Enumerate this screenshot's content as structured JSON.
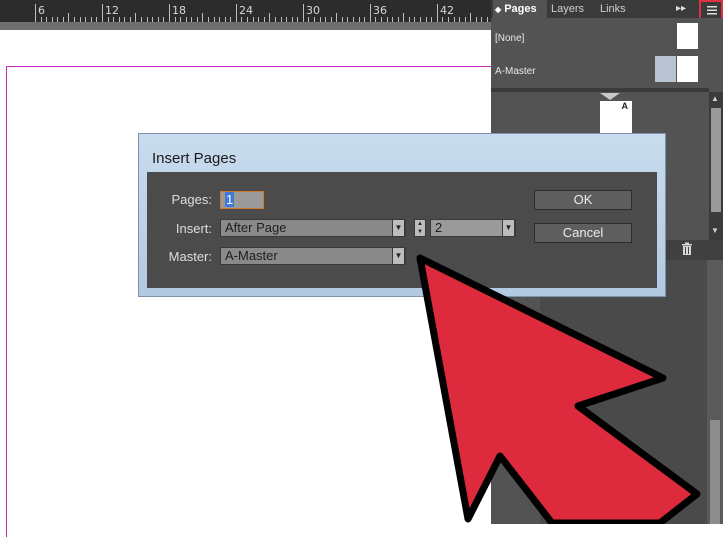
{
  "ruler": {
    "labels": [
      "6",
      "12",
      "18",
      "24",
      "30",
      "36",
      "42"
    ]
  },
  "panel": {
    "tabs": [
      "Pages",
      "Layers",
      "Links"
    ],
    "menu_icon": "panel-menu-icon",
    "expand_icon": "double-chevron-right-icon",
    "masters": [
      {
        "label": "[None]"
      },
      {
        "label": "A-Master"
      }
    ],
    "page_thumb_label": "A",
    "trash_icon": "trash-icon"
  },
  "dialog": {
    "title": "Insert Pages",
    "pages_label": "Pages:",
    "pages_value": "1",
    "insert_label": "Insert:",
    "insert_value": "After Page",
    "page_number_value": "2",
    "master_label": "Master:",
    "master_value": "A-Master",
    "ok_label": "OK",
    "cancel_label": "Cancel"
  },
  "annotation": {
    "color": "#dd2a3c",
    "icon": "red-arrow-pointer"
  }
}
